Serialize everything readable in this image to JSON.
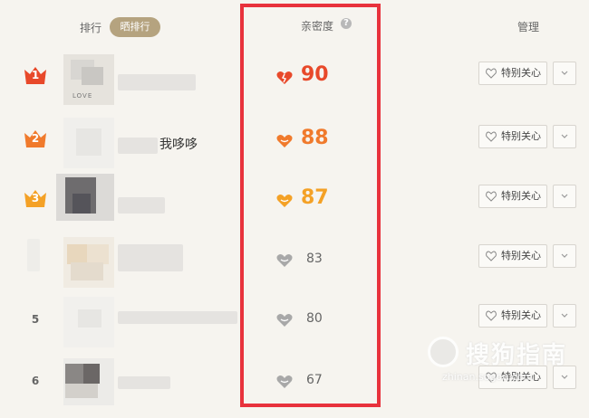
{
  "header": {
    "rank_label": "排行",
    "show_rank_label": "晒排行",
    "intimacy_label": "亲密度",
    "help_icon": "question-circle-icon",
    "manage_label": "管理"
  },
  "rows": [
    {
      "rank": "1",
      "badge": "crown",
      "badge_color": "#e8492a",
      "name": "",
      "score": "90",
      "score_color": "#e8492a",
      "heart": "heart-broken-icon",
      "care_label": "特别关心"
    },
    {
      "rank": "2",
      "badge": "crown",
      "badge_color": "#f07a2c",
      "name": "我哆哆",
      "score": "88",
      "score_color": "#f07a2c",
      "heart": "heart-icon",
      "care_label": "特别关心"
    },
    {
      "rank": "3",
      "badge": "crown",
      "badge_color": "#f4a126",
      "name": "",
      "score": "87",
      "score_color": "#f4a126",
      "heart": "heart-icon",
      "care_label": "特别关心"
    },
    {
      "rank": "",
      "badge": "none",
      "name": "",
      "score": "83",
      "heart": "heart-icon",
      "care_label": "特别关心"
    },
    {
      "rank": "5",
      "badge": "number",
      "name": "",
      "score": "80",
      "heart": "heart-icon",
      "care_label": "特别关心"
    },
    {
      "rank": "6",
      "badge": "number",
      "name": "",
      "score": "67",
      "heart": "heart-icon",
      "care_label": "特别关心"
    }
  ],
  "avatar_texts": {
    "row1": "LOVE"
  },
  "watermark": {
    "main": "搜狗指南",
    "sub": "zhinan.sogou.com"
  }
}
